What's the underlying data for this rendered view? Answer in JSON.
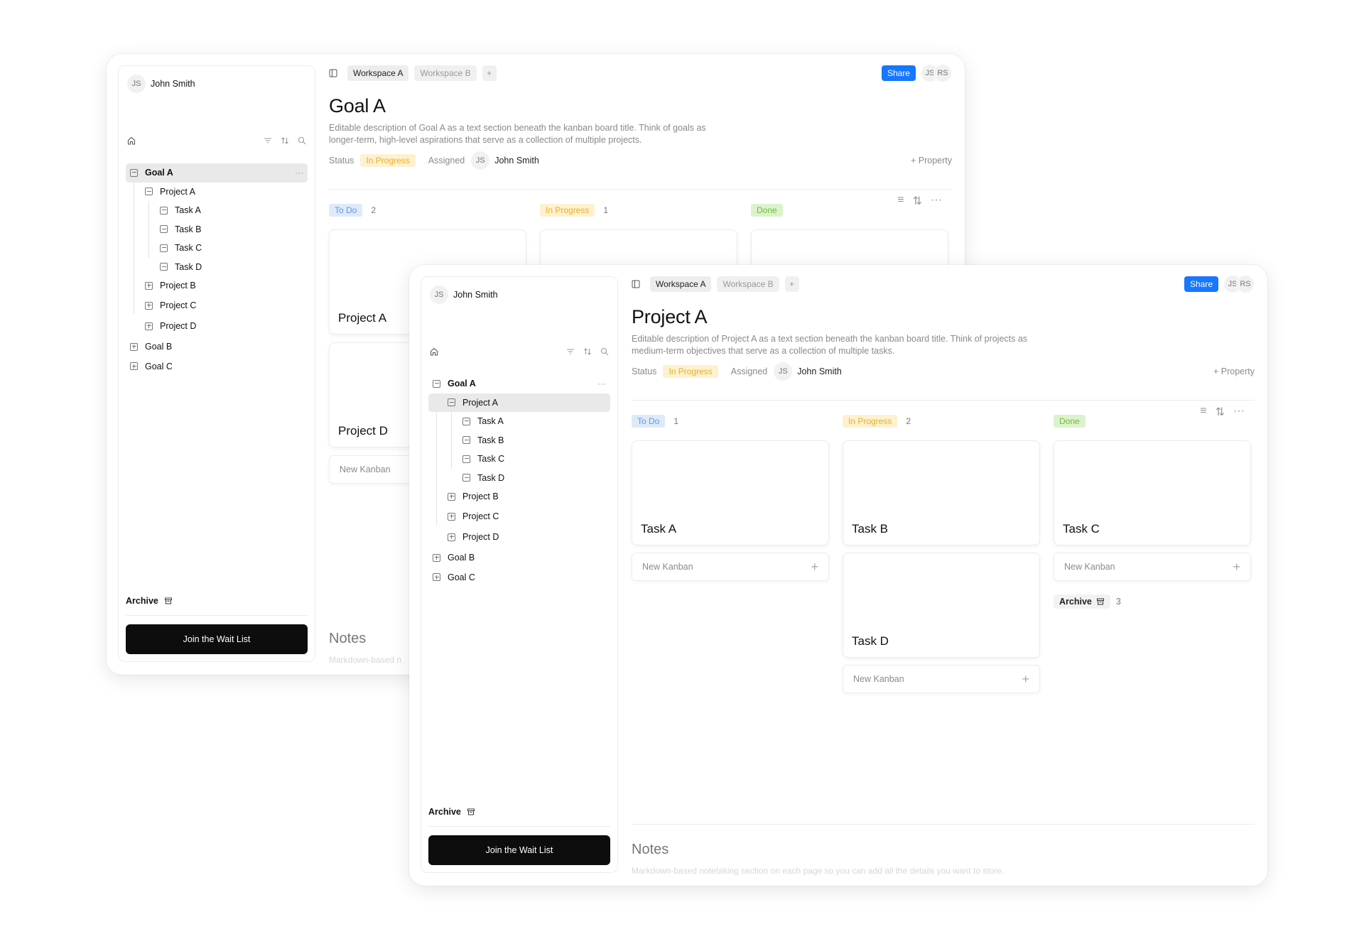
{
  "sidebar": {
    "user": {
      "initials": "JS",
      "name": "John Smith"
    },
    "tree": {
      "goal_a": "Goal A",
      "project_a": "Project A",
      "task_a": "Task A",
      "task_b": "Task B",
      "task_c": "Task C",
      "task_d": "Task D",
      "project_b": "Project B",
      "project_c": "Project C",
      "project_d": "Project D",
      "goal_b": "Goal B",
      "goal_c": "Goal C",
      "more": "···"
    },
    "archive": "Archive",
    "join": "Join the Wait List"
  },
  "header": {
    "tabs": [
      "Workspace A",
      "Workspace B",
      "+"
    ],
    "share": "Share",
    "avatars": [
      "JS",
      "RS"
    ]
  },
  "props": {
    "status_label": "Status",
    "status_value": "In Progress",
    "assigned_label": "Assigned",
    "assignee_initials": "JS",
    "assignee_name": "John Smith",
    "add_property": "+ Property"
  },
  "columns": {
    "todo": "To Do",
    "in_progress": "In Progress",
    "done": "Done"
  },
  "new_kanban": "New Kanban",
  "notes": {
    "title": "Notes",
    "desc_back": "Markdown-based n",
    "desc_front": "Markdown-based notetaking section on each page so you can add all the details you want to store."
  },
  "back": {
    "title": "Goal A",
    "desc": "Editable description of Goal A as a text section beneath the kanban board title. Think of goals as longer-term, high-level aspirations that serve as a collection of multiple projects.",
    "counts": {
      "todo": "2",
      "in_progress": "1"
    },
    "cards": {
      "c1": "Project A",
      "c2": "Project D"
    }
  },
  "front": {
    "title": "Project A",
    "desc": "Editable description of Project A as a text section beneath the kanban board title. Think of projects as medium-term objectives that serve as a collection of multiple tasks.",
    "counts": {
      "todo": "1",
      "in_progress": "2",
      "archive": "3"
    },
    "cards": {
      "task_a": "Task A",
      "task_b": "Task B",
      "task_c": "Task C",
      "task_d": "Task D"
    }
  },
  "colors": {
    "accent": "#1677ff",
    "in_progress": "#e6b12b",
    "todo": "#5b9be6",
    "done": "#6cbd3d"
  },
  "icons": [
    "user-avatar",
    "home-icon",
    "filter-icon",
    "sort-icon",
    "search-icon",
    "collapse-icon",
    "expand-icon",
    "archive-icon",
    "sidebar-toggle-icon",
    "plus-icon",
    "more-icon"
  ]
}
